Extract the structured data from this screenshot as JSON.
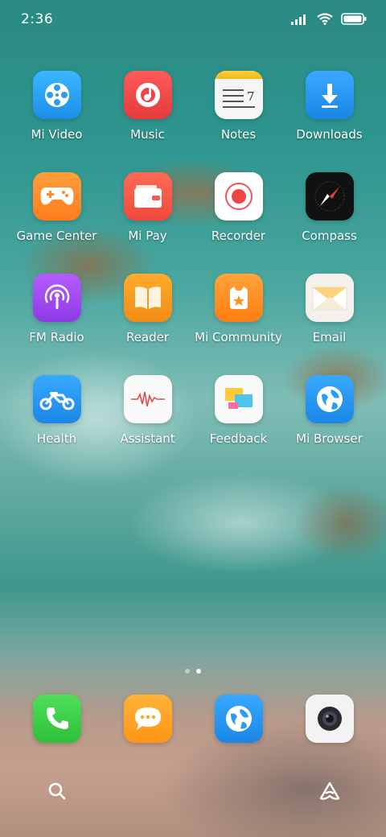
{
  "status_bar": {
    "time": "2:36",
    "icons": [
      "signal-icon",
      "wifi-icon",
      "battery-icon"
    ]
  },
  "apps": [
    {
      "label": "Mi Video",
      "icon": "mi-video-icon",
      "color": "#2aa8f2"
    },
    {
      "label": "Music",
      "icon": "music-icon",
      "color": "#f04a4a"
    },
    {
      "label": "Notes",
      "icon": "notes-icon",
      "color": "#f5f5f5"
    },
    {
      "label": "Downloads",
      "icon": "downloads-icon",
      "color": "#2b9cf0"
    },
    {
      "label": "Game Center",
      "icon": "game-center-icon",
      "color": "#ff8a2a"
    },
    {
      "label": "Mi Pay",
      "icon": "mi-pay-icon",
      "color": "#f55a4a"
    },
    {
      "label": "Recorder",
      "icon": "recorder-icon",
      "color": "#ffffff"
    },
    {
      "label": "Compass",
      "icon": "compass-icon",
      "color": "#111111"
    },
    {
      "label": "FM Radio",
      "icon": "fm-radio-icon",
      "color": "#a64cf0"
    },
    {
      "label": "Reader",
      "icon": "reader-icon",
      "color": "#f59a1e"
    },
    {
      "label": "Mi Community",
      "icon": "mi-community-icon",
      "color": "#ff8f1a"
    },
    {
      "label": "Email",
      "icon": "email-icon",
      "color": "#f4f0ea"
    },
    {
      "label": "Health",
      "icon": "health-icon",
      "color": "#2a9df4"
    },
    {
      "label": "Assistant",
      "icon": "assistant-icon",
      "color": "#fafafa"
    },
    {
      "label": "Feedback",
      "icon": "feedback-icon",
      "color": "#fafafa"
    },
    {
      "label": "Mi Browser",
      "icon": "mi-browser-icon",
      "color": "#2a9df4"
    }
  ],
  "page_indicator": {
    "pages": 2,
    "current": 2
  },
  "dock": [
    {
      "icon": "phone-icon",
      "color": "#3fd04a"
    },
    {
      "icon": "messaging-icon",
      "color": "#ffa426"
    },
    {
      "icon": "browser-icon",
      "color": "#2a9df4"
    },
    {
      "icon": "camera-icon",
      "color": "#f2f2f2"
    }
  ],
  "bottom_bar": {
    "left_icon": "search-icon",
    "right_icon": "assistant-shortcut-icon"
  }
}
